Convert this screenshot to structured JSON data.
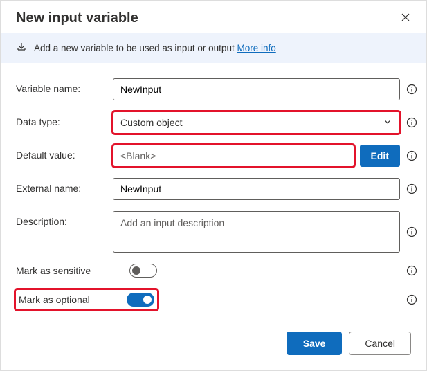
{
  "header": {
    "title": "New input variable"
  },
  "banner": {
    "text": "Add a new variable to be used as input or output ",
    "link_text": "More info"
  },
  "form": {
    "variable_name": {
      "label": "Variable name:",
      "value": "NewInput"
    },
    "data_type": {
      "label": "Data type:",
      "value": "Custom object"
    },
    "default_value": {
      "label": "Default value:",
      "value": "<Blank>",
      "edit_label": "Edit"
    },
    "external_name": {
      "label": "External name:",
      "value": "NewInput"
    },
    "description": {
      "label": "Description:",
      "placeholder": "Add an input description",
      "value": ""
    },
    "sensitive": {
      "label": "Mark as sensitive",
      "on": false
    },
    "optional": {
      "label": "Mark as optional",
      "on": true
    }
  },
  "footer": {
    "save": "Save",
    "cancel": "Cancel"
  }
}
